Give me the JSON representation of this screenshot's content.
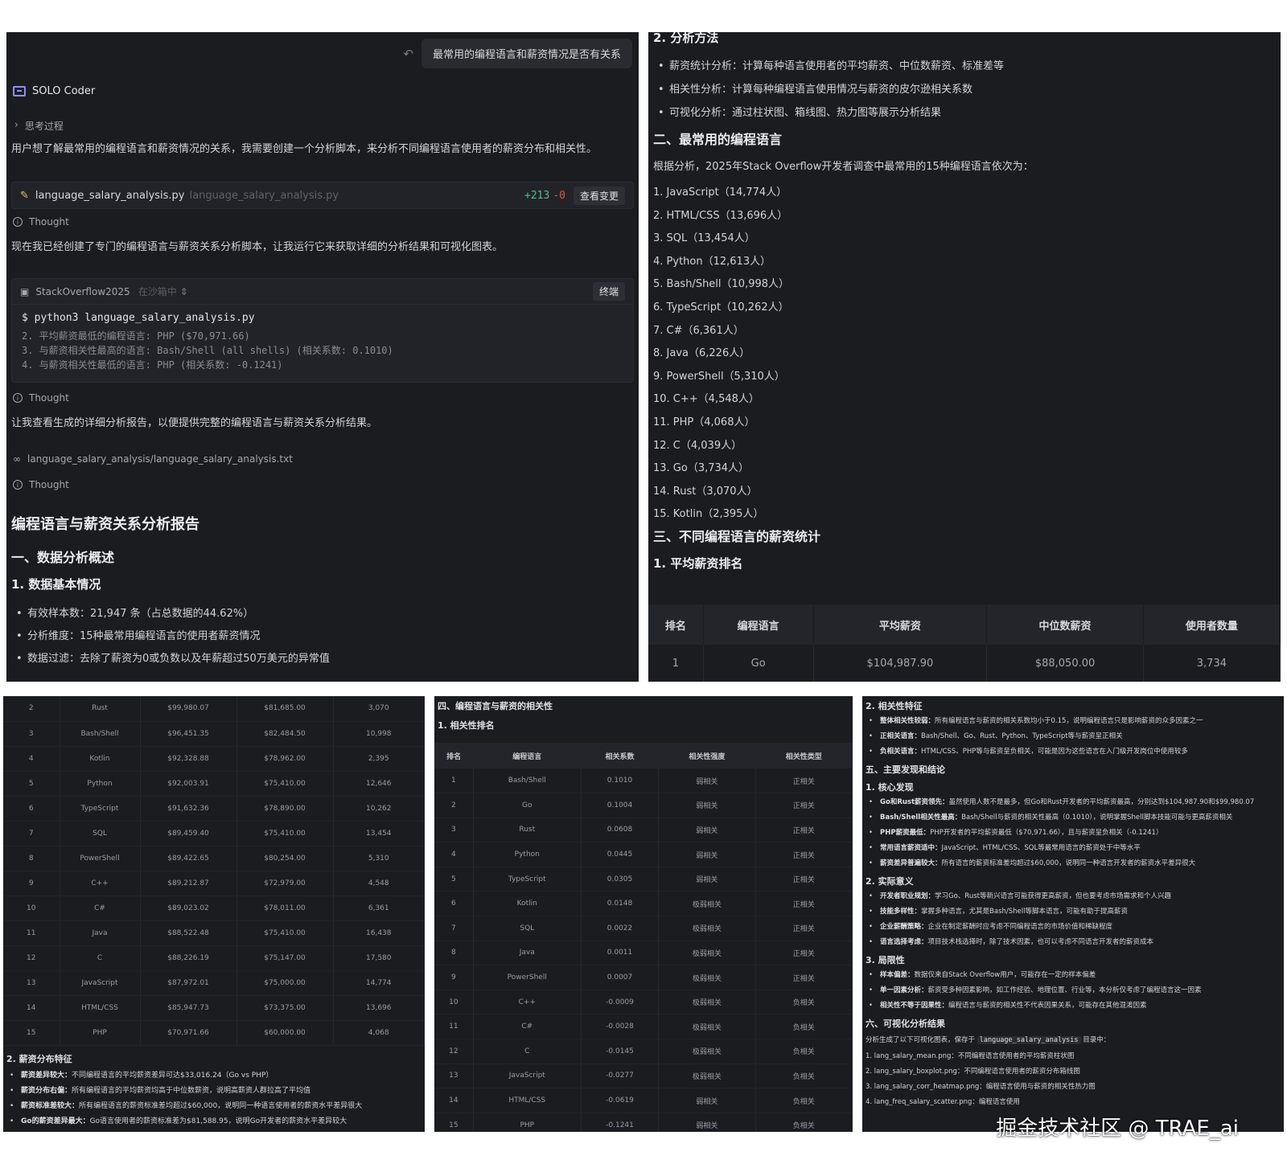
{
  "panel1": {
    "user_message": "最常用的编程语言和薪资情况是否有关系",
    "sender": "SOLO Coder",
    "thinking_label": "思考过程",
    "intro": "用户想了解最常用的编程语言和薪资情况的关系，我需要创建一个分析脚本，来分析不同编程语言使用者的薪资分布和相关性。",
    "file_card": {
      "name": "language_salary_analysis.py",
      "path": "language_salary_analysis.py",
      "added": "+213",
      "removed": "-0",
      "button": "查看变更"
    },
    "thought_label": "Thought",
    "para2": "现在我已经创建了专门的编程语言与薪资关系分析脚本，让我运行它来获取详细的分析结果和可视化图表。",
    "terminal": {
      "name": "StackOverflow2025",
      "tag": "在沙箱中",
      "button": "终端",
      "command": "$ python3 language_salary_analysis.py",
      "output": [
        "2. 平均薪资最低的编程语言: PHP ($70,971.66)",
        "3. 与薪资相关性最高的语言: Bash/Shell (all shells) (相关系数: 0.1010)",
        "4. 与薪资相关性最低的语言: PHP (相关系数: -0.1241)"
      ]
    },
    "para3": "让我查看生成的详细分析报告，以便提供完整的编程语言与薪资关系分析结果。",
    "read_file": "language_salary_analysis/language_salary_analysis.txt",
    "report_title": "编程语言与薪资关系分析报告",
    "sec1": "一、数据分析概述",
    "sec1_1": "1. 数据基本情况",
    "bullets": [
      "有效样本数：21,947 条（占总数据的44.62%）",
      "分析维度：15种最常用编程语言的使用者薪资情况",
      "数据过滤：去除了薪资为0或负数以及年薪超过50万美元的异常值"
    ]
  },
  "panel2": {
    "sec1_2": "2. 分析方法",
    "methods": [
      "薪资统计分析：计算每种语言使用者的平均薪资、中位数薪资、标准差等",
      "相关性分析：计算每种编程语言使用情况与薪资的皮尔逊相关系数",
      "可视化分析：通过柱状图、箱线图、热力图等展示分析结果"
    ],
    "sec2": "二、最常用的编程语言",
    "sec2_intro": "根据分析，2025年Stack Overflow开发者调查中最常用的15种编程语言依次为：",
    "languages": [
      "1. JavaScript（14,774人）",
      "2. HTML/CSS（13,696人）",
      "3. SQL（13,454人）",
      "4. Python（12,613人）",
      "5. Bash/Shell（10,998人）",
      "6. TypeScript（10,262人）",
      "7. C#（6,361人）",
      "8. Java（6,226人）",
      "9. PowerShell（5,310人）",
      "10. C++（4,548人）",
      "11. PHP（4,068人）",
      "12. C（4,039人）",
      "13. Go（3,734人）",
      "14. Rust（3,070人）",
      "15. Kotlin（2,395人）"
    ],
    "sec3": "三、不同编程语言的薪资统计",
    "sec3_1": "1. 平均薪资排名",
    "table_headers": [
      "排名",
      "编程语言",
      "平均薪资",
      "中位数薪资",
      "使用者数量"
    ],
    "first_row": [
      "1",
      "Go",
      "$104,987.90",
      "$88,050.00",
      "3,734"
    ]
  },
  "panel3": {
    "rows": [
      [
        "2",
        "Rust",
        "$99,980.07",
        "$81,685.00",
        "3,070"
      ],
      [
        "3",
        "Bash/Shell",
        "$96,451.35",
        "$82,484.50",
        "10,998"
      ],
      [
        "4",
        "Kotlin",
        "$92,328.88",
        "$78,962.00",
        "2,395"
      ],
      [
        "5",
        "Python",
        "$92,003.91",
        "$75,410.00",
        "12,646"
      ],
      [
        "6",
        "TypeScript",
        "$91,632.36",
        "$78,890.00",
        "10,262"
      ],
      [
        "7",
        "SQL",
        "$89,459.40",
        "$75,410.00",
        "13,454"
      ],
      [
        "8",
        "PowerShell",
        "$89,422.65",
        "$80,254.00",
        "5,310"
      ],
      [
        "9",
        "C++",
        "$89,212.87",
        "$72,979.00",
        "4,548"
      ],
      [
        "10",
        "C#",
        "$89,023.02",
        "$78,011.00",
        "6,361"
      ],
      [
        "11",
        "Java",
        "$88,522.48",
        "$75,410.00",
        "16,438"
      ],
      [
        "12",
        "C",
        "$88,226.19",
        "$75,147.00",
        "17,580"
      ],
      [
        "13",
        "JavaScript",
        "$87,972.01",
        "$75,000.00",
        "14,774"
      ],
      [
        "14",
        "HTML/CSS",
        "$85,947.73",
        "$73,375.00",
        "13,696"
      ],
      [
        "15",
        "PHP",
        "$70,971.66",
        "$60,000.00",
        "4,068"
      ]
    ],
    "sub_title": "2. 薪资分布特征",
    "bullets": [
      {
        "b": "薪资差异较大：",
        "t": "不同编程语言的平均薪资差异可达$33,016.24（Go vs PHP）"
      },
      {
        "b": "薪资分布右偏：",
        "t": "所有编程语言的平均薪资均高于中位数薪资，说明高薪资人群拉高了平均值"
      },
      {
        "b": "薪资标准差较大：",
        "t": "所有编程语言的薪资标准差均超过$60,000，说明同一种语言使用者的薪资水平差异很大"
      },
      {
        "b": "Go的薪资差异最大：",
        "t": "Go语言使用者的薪资标准差为$81,588.95，说明Go开发者的薪资水平差异较大"
      }
    ]
  },
  "panel4": {
    "sec4": "四、编程语言与薪资的相关性",
    "sec4_1": "1. 相关性排名",
    "headers": [
      "排名",
      "编程语言",
      "相关系数",
      "相关性强度",
      "相关性类型"
    ],
    "rows": [
      [
        "1",
        "Bash/Shell",
        "0.1010",
        "弱相关",
        "正相关"
      ],
      [
        "2",
        "Go",
        "0.1004",
        "弱相关",
        "正相关"
      ],
      [
        "3",
        "Rust",
        "0.0608",
        "弱相关",
        "正相关"
      ],
      [
        "4",
        "Python",
        "0.0445",
        "弱相关",
        "正相关"
      ],
      [
        "5",
        "TypeScript",
        "0.0305",
        "弱相关",
        "正相关"
      ],
      [
        "6",
        "Kotlin",
        "0.0148",
        "极弱相关",
        "正相关"
      ],
      [
        "7",
        "SQL",
        "0.0022",
        "极弱相关",
        "正相关"
      ],
      [
        "8",
        "Java",
        "0.0011",
        "极弱相关",
        "正相关"
      ],
      [
        "9",
        "PowerShell",
        "0.0007",
        "极弱相关",
        "正相关"
      ],
      [
        "10",
        "C++",
        "-0.0009",
        "极弱相关",
        "负相关"
      ],
      [
        "11",
        "C#",
        "-0.0028",
        "极弱相关",
        "负相关"
      ],
      [
        "12",
        "C",
        "-0.0145",
        "极弱相关",
        "负相关"
      ],
      [
        "13",
        "JavaScript",
        "-0.0277",
        "极弱相关",
        "负相关"
      ],
      [
        "14",
        "HTML/CSS",
        "-0.0619",
        "弱相关",
        "负相关"
      ],
      [
        "15",
        "PHP",
        "-0.1241",
        "弱相关",
        "负相关"
      ]
    ]
  },
  "panel5": {
    "sec4_2": "2. 相关性特征",
    "corr_bullets": [
      {
        "b": "整体相关性较弱：",
        "t": "所有编程语言与薪资的相关系数均小于0.15，说明编程语言只是影响薪资的众多因素之一"
      },
      {
        "b": "正相关语言：",
        "t": "Bash/Shell、Go、Rust、Python、TypeScript等与薪资呈正相关"
      },
      {
        "b": "负相关语言：",
        "t": "HTML/CSS、PHP等与薪资呈负相关，可能是因为这些语言在入门级开发岗位中使用较多"
      }
    ],
    "sec5": "五、主要发现和结论",
    "sec5_1": "1. 核心发现",
    "core_bullets": [
      {
        "b": "Go和Rust薪资领先：",
        "t": "虽然使用人数不是最多，但Go和Rust开发者的平均薪资最高，分别达到$104,987.90和$99,980.07"
      },
      {
        "b": "Bash/Shell相关性最高：",
        "t": "Bash/Shell与薪资的相关性最高（0.1010），说明掌握Shell脚本技能可能与更高薪资相关"
      },
      {
        "b": "PHP薪资最低：",
        "t": "PHP开发者的平均薪资最低（$70,971.66），且与薪资呈负相关（-0.1241）"
      },
      {
        "b": "常用语言薪资适中：",
        "t": "JavaScript、HTML/CSS、SQL等最常用语言的薪资处于中等水平"
      },
      {
        "b": "薪资差异普遍较大：",
        "t": "所有语言的薪资标准差均超过$60,000，说明同一种语言开发者的薪资水平差异很大"
      }
    ],
    "sec5_2": "2. 实际意义",
    "practical_bullets": [
      {
        "b": "开发者职业规划：",
        "t": "学习Go、Rust等新兴语言可能获得更高薪资，但也要考虑市场需求和个人兴趣"
      },
      {
        "b": "技能多样性：",
        "t": "掌握多种语言，尤其是Bash/Shell等脚本语言，可能有助于提高薪资"
      },
      {
        "b": "企业薪酬策略：",
        "t": "企业在制定薪酬时应考虑不同编程语言的市场价值和稀缺程度"
      },
      {
        "b": "语言选择考虑：",
        "t": "项目技术栈选择时，除了技术因素，也可以考虑不同语言开发者的薪资成本"
      }
    ],
    "sec5_3": "3. 局限性",
    "limit_bullets": [
      {
        "b": "样本偏差：",
        "t": "数据仅来自Stack Overflow用户，可能存在一定的样本偏差"
      },
      {
        "b": "单一因素分析：",
        "t": "薪资受多种因素影响，如工作经验、地理位置、行业等，本分析仅考虑了编程语言这一因素"
      },
      {
        "b": "相关性不等于因果性：",
        "t": "编程语言与薪资的相关性不代表因果关系，可能存在其他混淆因素"
      }
    ],
    "sec6": "六、可视化分析结果",
    "sec6_note_pre": "分析生成了以下可视化图表，保存于",
    "sec6_note_code": "language_salary_analysis",
    "sec6_note_post": "目录中：",
    "charts": [
      "1. lang_salary_mean.png：不同编程语言使用者的平均薪资柱状图",
      "2. lang_salary_boxplot.png：不同编程语言使用者的薪资分布箱线图",
      "3. lang_salary_corr_heatmap.png：编程语言使用与薪资的相关性热力图",
      "4. lang_freq_salary_scatter.png：编程语言使用"
    ]
  },
  "watermark": "掘金技术社区 @ TRAE_ai"
}
